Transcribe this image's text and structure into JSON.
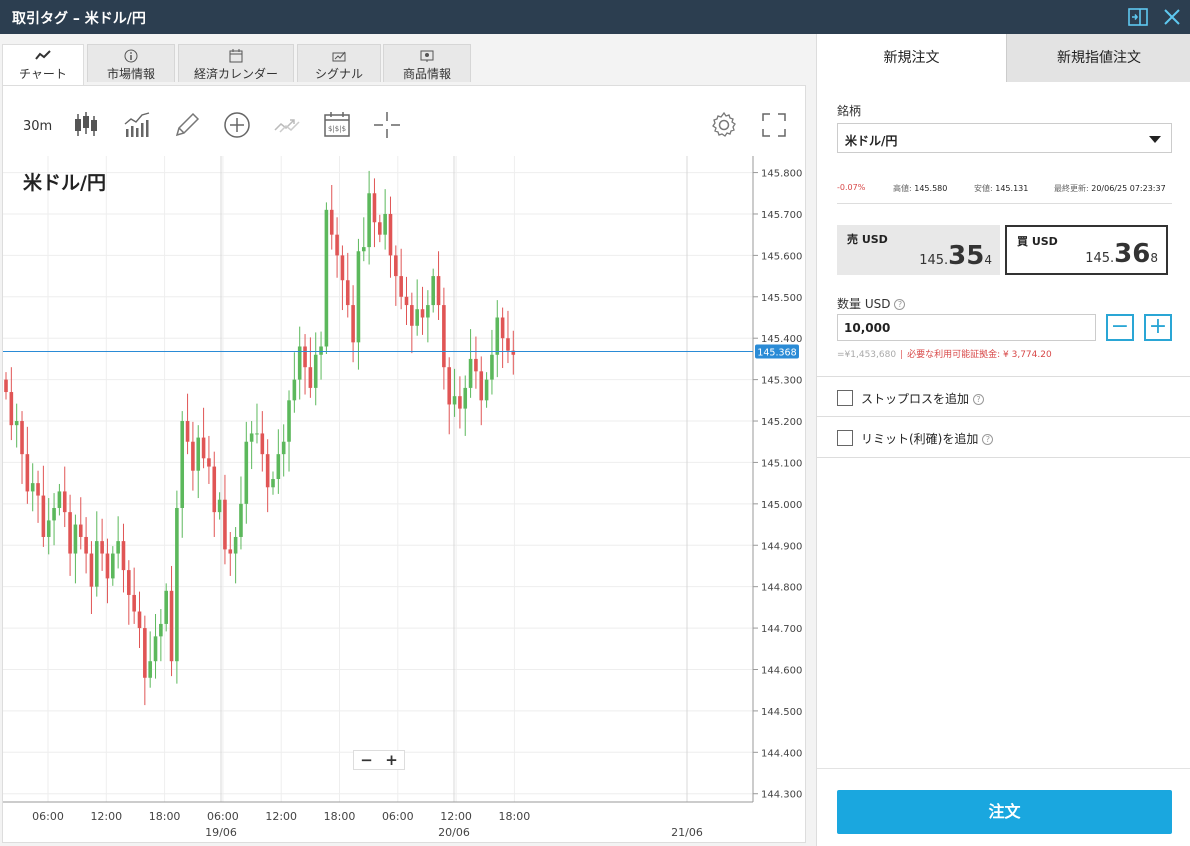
{
  "window": {
    "title": "取引タグ – 米ドル/円"
  },
  "tabs": [
    {
      "label": "チャート",
      "icon": "line-chart-icon"
    },
    {
      "label": "市場情報",
      "icon": "info-icon"
    },
    {
      "label": "経済カレンダー",
      "icon": "calendar-icon"
    },
    {
      "label": "シグナル",
      "icon": "signal-icon"
    },
    {
      "label": "商品情報",
      "icon": "product-info-icon"
    }
  ],
  "toolbar": {
    "period": "30m",
    "tools": [
      "candlestick-icon",
      "indicators-icon",
      "draw-pencil-icon",
      "add-circle-icon",
      "compare-icon",
      "calendar-events-icon",
      "crosshair-icon",
      "settings-gear-icon",
      "fullscreen-icon"
    ]
  },
  "chart_data": {
    "type": "candlestick",
    "symbol": "米ドル/円",
    "interval": "30m",
    "ylim": [
      144.28,
      145.84
    ],
    "y_ticks": [
      "145.800",
      "145.700",
      "145.600",
      "145.500",
      "145.400",
      "145.300",
      "145.200",
      "145.100",
      "145.000",
      "144.900",
      "144.800",
      "144.700",
      "144.600",
      "144.500",
      "144.400",
      "144.300"
    ],
    "x_time_labels": [
      "06:00",
      "12:00",
      "18:00",
      "06:00",
      "12:00",
      "18:00",
      "06:00",
      "12:00",
      "18:00"
    ],
    "x_date_labels": [
      "19/06",
      "20/06",
      "21/06"
    ],
    "current_price": "145.368",
    "colors": {
      "up": "#5cb85c",
      "down": "#e05555",
      "price_line": "#2a8bd6"
    },
    "closes": [
      145.27,
      145.19,
      145.2,
      145.12,
      145.03,
      145.05,
      145.02,
      144.92,
      144.96,
      144.99,
      145.03,
      144.98,
      144.88,
      144.95,
      144.92,
      144.88,
      144.8,
      144.91,
      144.88,
      144.82,
      144.88,
      144.91,
      144.84,
      144.78,
      144.74,
      144.7,
      144.58,
      144.62,
      144.68,
      144.71,
      144.79,
      144.62,
      144.99,
      145.2,
      145.15,
      145.08,
      145.16,
      145.11,
      145.09,
      144.98,
      145.01,
      144.89,
      144.88,
      144.92,
      145.0,
      145.15,
      145.17,
      145.17,
      145.12,
      145.04,
      145.06,
      145.12,
      145.15,
      145.25,
      145.3,
      145.38,
      145.33,
      145.28,
      145.36,
      145.38,
      145.71,
      145.65,
      145.6,
      145.54,
      145.48,
      145.39,
      145.61,
      145.62,
      145.75,
      145.68,
      145.65,
      145.7,
      145.6,
      145.55,
      145.5,
      145.48,
      145.43,
      145.47,
      145.45,
      145.48,
      145.55,
      145.48,
      145.33,
      145.24,
      145.26,
      145.23,
      145.28,
      145.35,
      145.32,
      145.25,
      145.3,
      145.36,
      145.45,
      145.4,
      145.37,
      145.36
    ],
    "volatility": 0.06
  },
  "order_panel": {
    "tabs": {
      "new_order": "新規注文",
      "new_limit_order": "新規指値注文"
    },
    "symbol_label": "銘柄",
    "symbol_value": "米ドル/円",
    "stats": {
      "change": "-0.07%",
      "high_label": "高値:",
      "high_value": "145.580",
      "low_label": "安値:",
      "low_value": "145.131",
      "updated_label": "最終更新:",
      "updated_value": "20/06/25 07:23:37"
    },
    "sell": {
      "label": "売 USD",
      "p1": "145.",
      "p2": "35",
      "p3": "4"
    },
    "buy": {
      "label": "買 USD",
      "p1": "145.",
      "p2": "36",
      "p3": "8"
    },
    "quantity_label": "数量 USD",
    "quantity_value": "10,000",
    "minus": "−",
    "plus": "+",
    "notional": "=¥1,453,680",
    "margin_note": "必要な利用可能証拠金: ¥ 3,774.20",
    "stop_loss": "ストップロスを追加",
    "limit": "リミット(利確)を追加",
    "submit": "注文"
  }
}
